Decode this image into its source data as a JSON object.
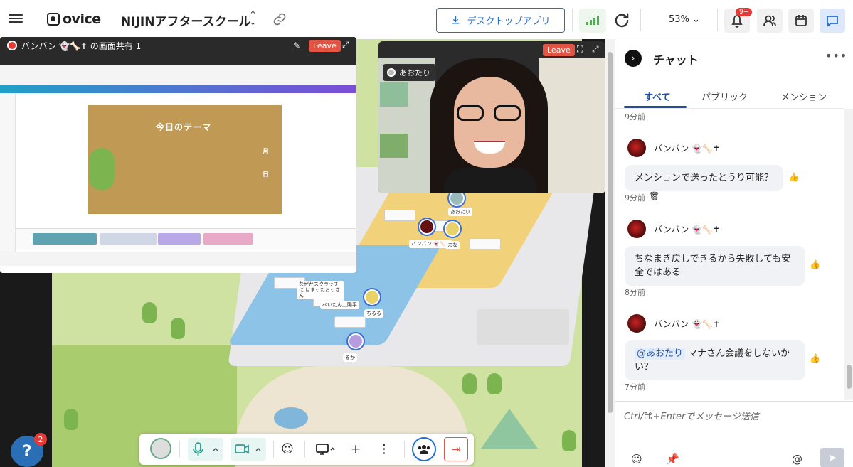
{
  "app": {
    "logo_text": "ovice",
    "space_title": "NIJINアフタースクール"
  },
  "toolbar": {
    "desktop_app_label": "デスクトップアプリ",
    "zoom_level": "53%",
    "notification_badge": "9+",
    "signal_color": "#4caf50",
    "accent_color": "#1f6fd1"
  },
  "screen_share": {
    "title": "バンバン 👻🦴✝ の画面共有 1",
    "leave_label": "Leave",
    "design_title": "今日のテーマ",
    "design_month": "月",
    "design_day": "日"
  },
  "video": {
    "name": "あおたり",
    "leave_label": "Leave"
  },
  "map": {
    "avatars": [
      {
        "label": "あおたり"
      },
      {
        "label": "バンバン 👻🦴✝"
      },
      {
        "label": "まな"
      },
      {
        "label": "べいたん＿陽平"
      },
      {
        "label": "ちるる"
      },
      {
        "label": "るか"
      }
    ],
    "bubble_text": "なぜかスクラッチに はまったおっさん"
  },
  "help": {
    "badge": "2"
  },
  "chat": {
    "title": "チャット",
    "tabs": [
      "すべて",
      "パブリック",
      "メンション"
    ],
    "active_tab": "すべて",
    "messages": [
      {
        "timestamp": "9分前"
      },
      {
        "author": "バンバン 👻🦴✝",
        "text": "メンションで送ったとうり可能？",
        "timestamp": "9分前"
      },
      {
        "author": "バンバン 👻🦴✝",
        "text": "ちなまき戻しできるから失敗しても安全ではある",
        "timestamp": "8分前"
      },
      {
        "author": "バンバン 👻🦴✝",
        "mention": "@あおたり",
        "text": "マナさん会議をしないかい？",
        "timestamp": "7分前"
      }
    ],
    "compose_placeholder": "Ctrl/⌘+Enterでメッセージ送信"
  }
}
